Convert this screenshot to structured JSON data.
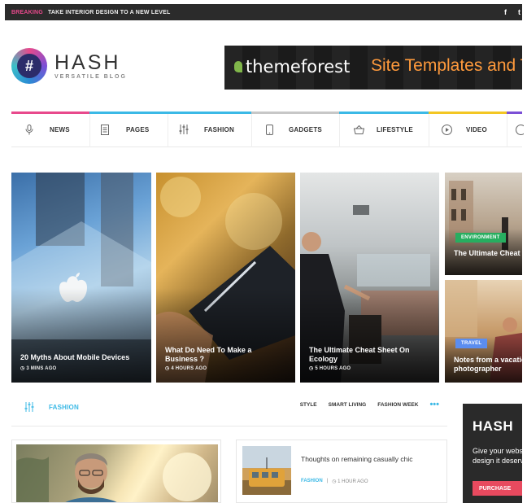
{
  "topbar": {
    "breaking_label": "BREAKING",
    "breaking_text": "TAKE INTERIOR DESIGN TO A NEW LEVEL",
    "social": [
      "f",
      "t"
    ]
  },
  "brand": {
    "title": "HASH",
    "subtitle": "VERSATILE BLOG",
    "mark": "#"
  },
  "banner": {
    "logo": "themeforest",
    "slogan": "Site Templates and Th"
  },
  "nav": {
    "items": [
      {
        "label": "NEWS",
        "icon": "microphone-icon",
        "color": "#e8498c"
      },
      {
        "label": "PAGES",
        "icon": "document-icon",
        "color": "#3bb9e6"
      },
      {
        "label": "FASHION",
        "icon": "sliders-icon",
        "color": "#3bb9e6"
      },
      {
        "label": "GADGETS",
        "icon": "phone-icon",
        "color": "#c7c7c7"
      },
      {
        "label": "LIFESTYLE",
        "icon": "basket-icon",
        "color": "#3bb9e6"
      },
      {
        "label": "VIDEO",
        "icon": "play-icon",
        "color": "#f3c623"
      },
      {
        "label": "",
        "icon": "more-icon",
        "color": "#7b4fd6"
      }
    ]
  },
  "featured": [
    {
      "title": "20 Myths About Mobile Devices",
      "meta": "3 MINS AGO"
    },
    {
      "title": "What Do Need To Make a Business ?",
      "meta": "4 HOURS AGO"
    },
    {
      "title": "The Ultimate Cheat Sheet On Ecology",
      "meta": "5 HOURS AGO"
    },
    {
      "tag": "ENVIRONMENT",
      "title": "The Ultimate Cheat Sheet On Ecology"
    },
    {
      "tag": "TRAVEL",
      "title": "Notes from a vacation photographer"
    }
  ],
  "section": {
    "title": "FASHION",
    "links": [
      "STYLE",
      "SMART LIVING",
      "FASHION WEEK"
    ],
    "more": "•••"
  },
  "small_post": {
    "title": "Thoughts on remaining casually chic",
    "category": "FASHION",
    "separator": "|",
    "time": "1 HOUR AGO"
  },
  "ad": {
    "title": "HASH",
    "line1": "Give your website",
    "line2": "design it deserves",
    "button": "PURCHASE"
  }
}
